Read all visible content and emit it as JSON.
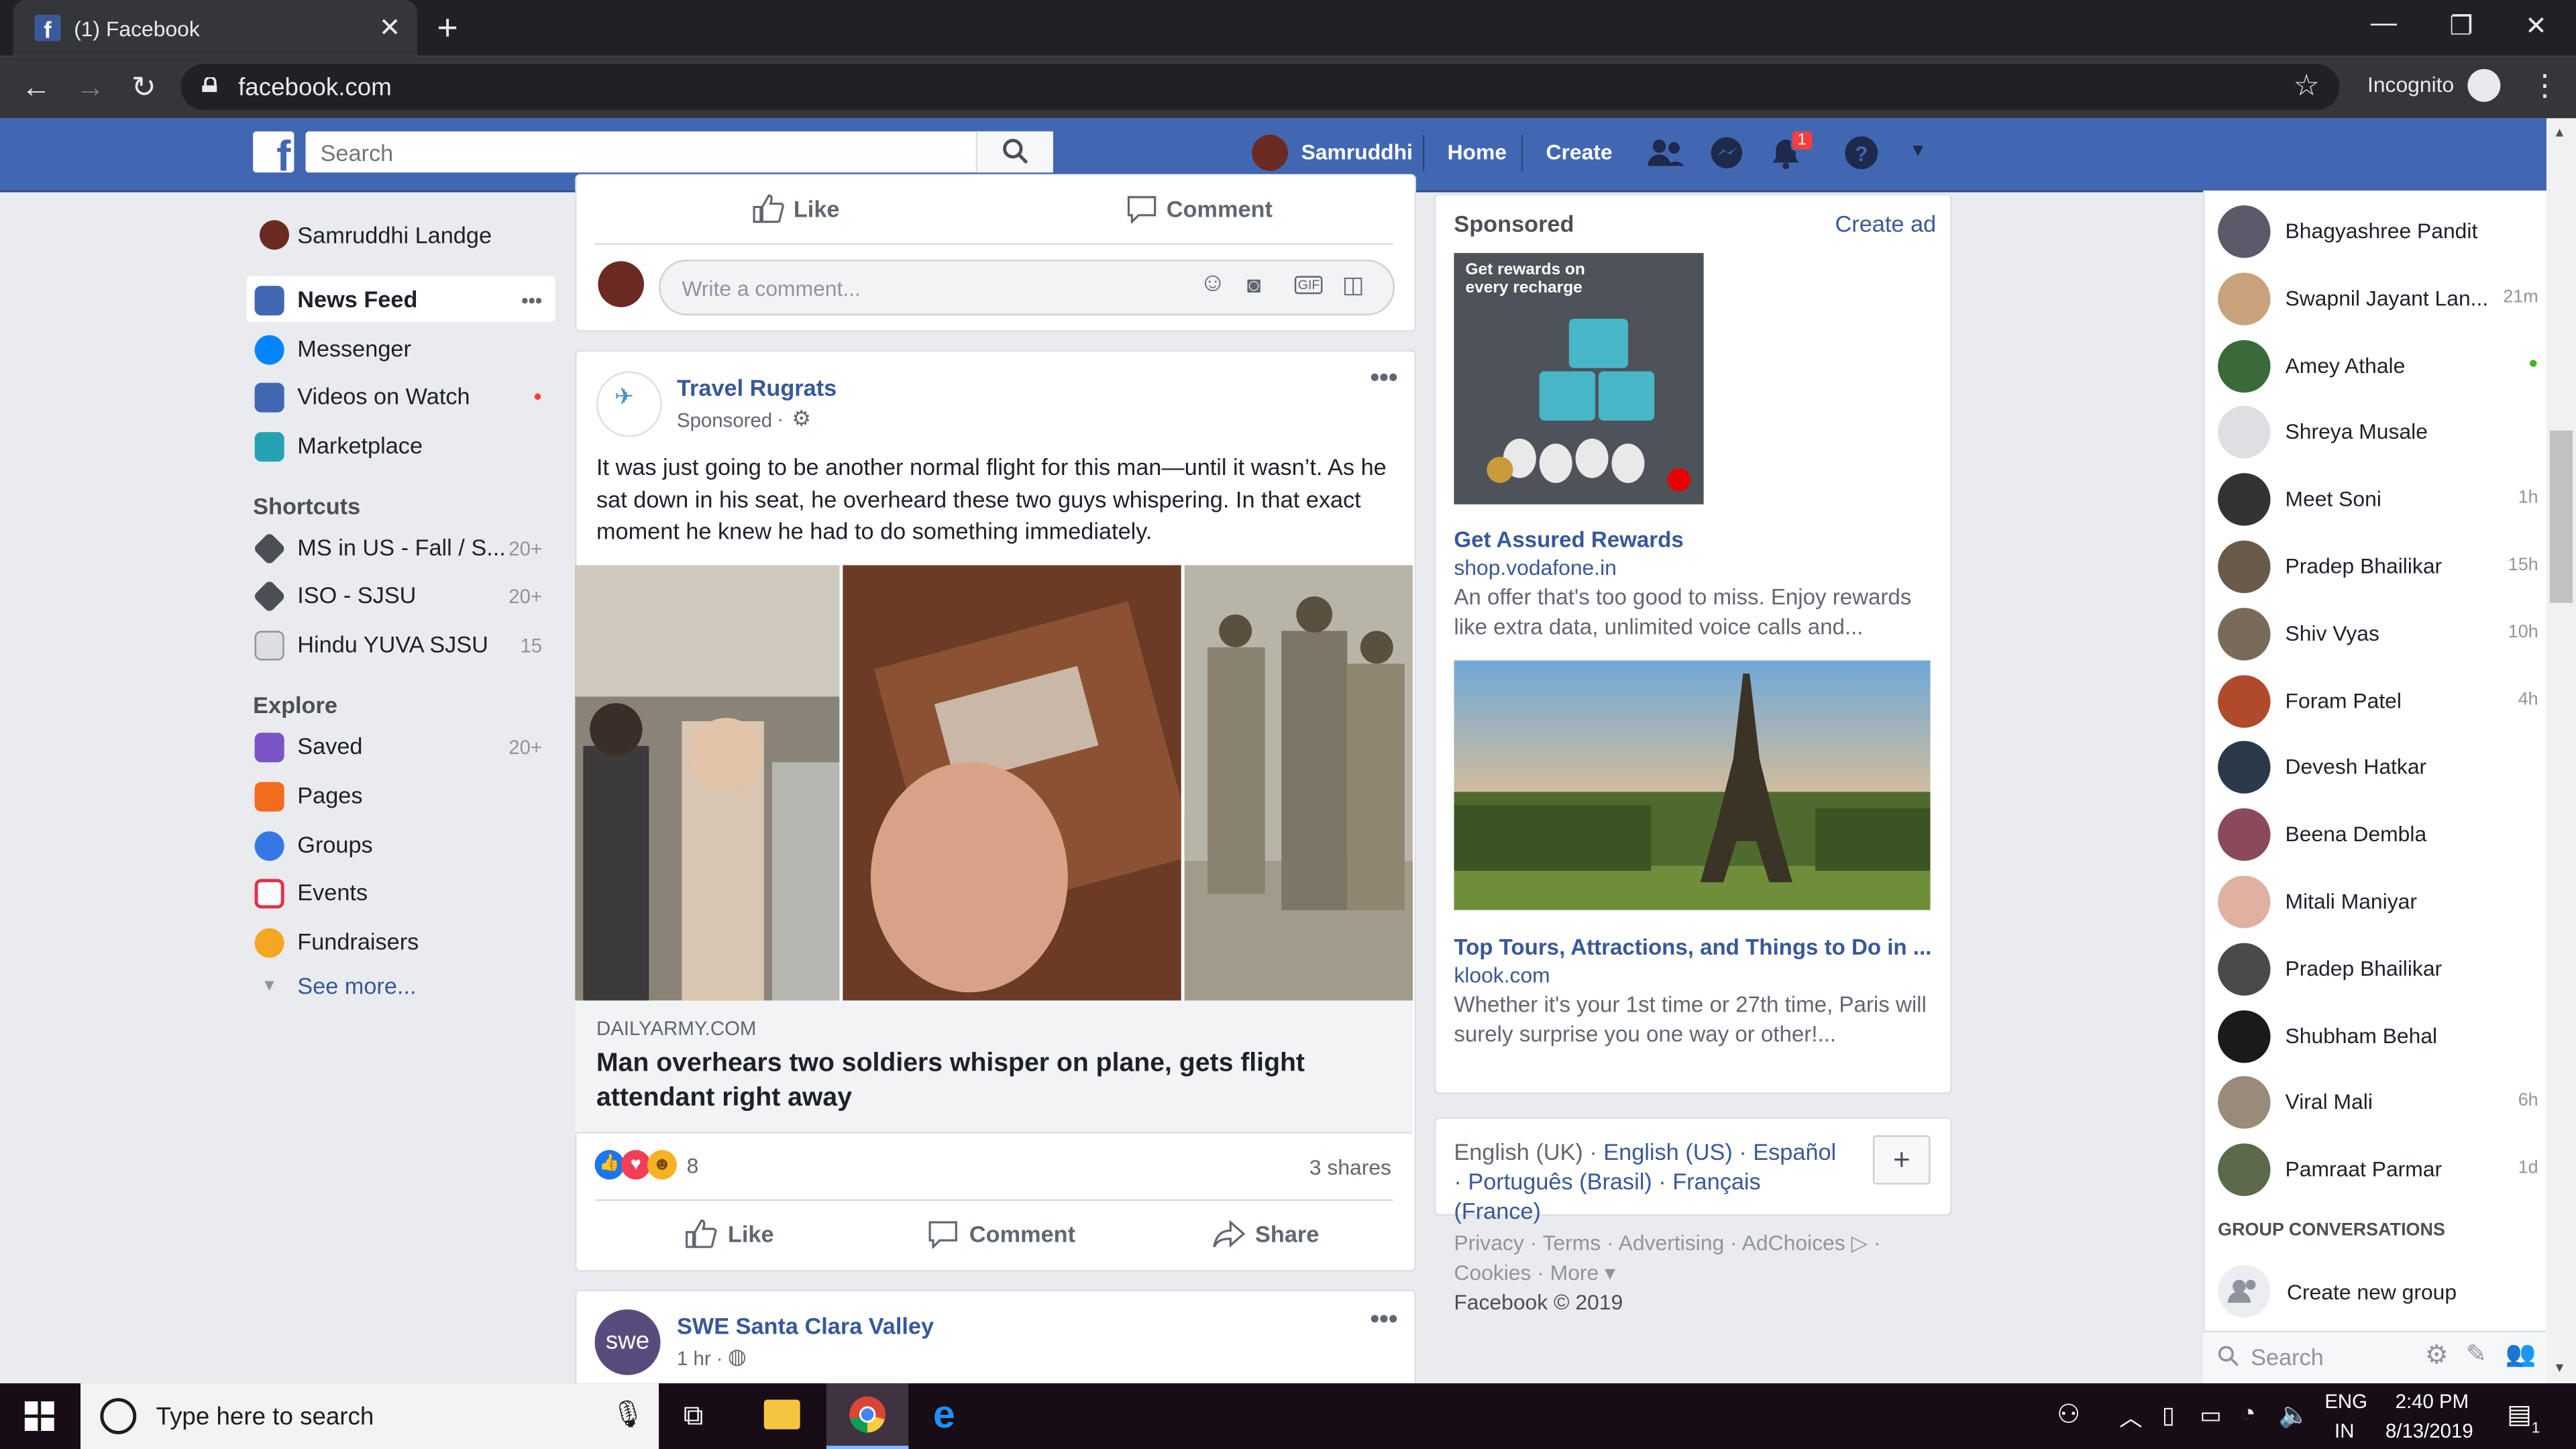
{
  "browser": {
    "tab_title": "(1) Facebook",
    "tab_favicon": "f",
    "url": "facebook.com",
    "incognito_label": "Incognito"
  },
  "fb_header": {
    "logo": "f",
    "search_placeholder": "Search",
    "user_name": "Samruddhi",
    "nav_home": "Home",
    "nav_create": "Create",
    "notification_count": "1"
  },
  "left_nav": {
    "profile_name": "Samruddhi Landge",
    "items": [
      {
        "label": "News Feed",
        "count": "•••",
        "color": "#4267b2"
      },
      {
        "label": "Messenger",
        "count": "",
        "color": "#0084ff"
      },
      {
        "label": "Videos on Watch",
        "count": "●",
        "color": "#4267b2"
      },
      {
        "label": "Marketplace",
        "count": "",
        "color": "#25a3b5"
      }
    ],
    "shortcuts_title": "Shortcuts",
    "shortcuts": [
      {
        "label": "MS in US - Fall / S...",
        "count": "20+"
      },
      {
        "label": "ISO - SJSU",
        "count": "20+"
      },
      {
        "label": "Hindu YUVA SJSU",
        "count": "15"
      }
    ],
    "explore_title": "Explore",
    "explore": [
      {
        "label": "Saved",
        "count": "20+",
        "color": "#7b55c4"
      },
      {
        "label": "Pages",
        "count": "",
        "color": "#f36b1c"
      },
      {
        "label": "Groups",
        "count": "",
        "color": "#3578e5"
      },
      {
        "label": "Events",
        "count": "",
        "color": "#e4304b"
      },
      {
        "label": "Fundraisers",
        "count": "",
        "color": "#f5a623"
      }
    ],
    "see_more": "See more..."
  },
  "prev_post": {
    "like": "Like",
    "comment": "Comment",
    "comment_placeholder": "Write a comment..."
  },
  "post": {
    "author": "Travel Rugrats",
    "sponsored": "Sponsored",
    "text": "It was just going to be another normal flight for this man—until it wasn’t. As he sat down in his seat, he overheard these two guys whispering. In that exact moment he knew he had to do something immediately.",
    "link_domain": "DAILYARMY.COM",
    "link_title": "Man overhears two soldiers whisper on plane, gets flight attendant right away",
    "reaction_count": "8",
    "shares": "3 shares",
    "like": "Like",
    "comment": "Comment",
    "share": "Share"
  },
  "next_post": {
    "author": "SWE Santa Clara Valley",
    "time": "1 hr ·",
    "logo_text": "swe"
  },
  "sponsored": {
    "title": "Sponsored",
    "create_ad": "Create ad",
    "ads": [
      {
        "image_caption": "Get rewards on every recharge",
        "headline": "Get Assured Rewards",
        "domain": "shop.vodafone.in",
        "desc": "An offer that's too good to miss. Enjoy rewards like extra data, unlimited voice calls and..."
      },
      {
        "headline": "Top Tours, Attractions, and Things to Do in ...",
        "domain": "klook.com",
        "desc": "Whether it's your 1st time or 27th time, Paris will surely surprise you one way or other!..."
      }
    ]
  },
  "languages": {
    "current": "English (UK) ·",
    "options": [
      "English (US) ·",
      "Español ·",
      "Português (Brasil) ·",
      "Français (France)"
    ]
  },
  "footer": {
    "line1": "Privacy · Terms · Advertising · AdChoices ▷ ·",
    "line2": "Cookies · More ▾",
    "copyright": "Facebook © 2019"
  },
  "chat": {
    "contacts": [
      {
        "name": "Bhagyashree Pandit",
        "time": "",
        "color": "#5a5a6a"
      },
      {
        "name": "Swapnil Jayant Lan...",
        "time": "21m",
        "color": "#c8a27a"
      },
      {
        "name": "Amey Athale",
        "time": "●",
        "color": "#3a6a3a"
      },
      {
        "name": "Shreya Musale",
        "time": "",
        "color": "#dddfe2"
      },
      {
        "name": "Meet Soni",
        "time": "1h",
        "color": "#333333"
      },
      {
        "name": "Pradep Bhailikar",
        "time": "15h",
        "color": "#6a5a4a"
      },
      {
        "name": "Shiv Vyas",
        "time": "10h",
        "color": "#7a6a5a"
      },
      {
        "name": "Foram Patel",
        "time": "4h",
        "color": "#b04a2a"
      },
      {
        "name": "Devesh Hatkar",
        "time": "",
        "color": "#2a3a4a"
      },
      {
        "name": "Beena Dembla",
        "time": "",
        "color": "#8a4a5a"
      },
      {
        "name": "Mitali Maniyar",
        "time": "",
        "color": "#e0b0a0"
      },
      {
        "name": "Pradep Bhailikar",
        "time": "",
        "color": "#4a4a4a"
      },
      {
        "name": "Shubham Behal",
        "time": "",
        "color": "#1a1a1a"
      },
      {
        "name": "Viral Mali",
        "time": "6h",
        "color": "#9a8a7a"
      },
      {
        "name": "Pamraat Parmar",
        "time": "1d",
        "color": "#5a6a4a"
      }
    ],
    "group_title": "GROUP CONVERSATIONS",
    "create_group": "Create new group",
    "search_placeholder": "Search"
  },
  "taskbar": {
    "search_placeholder": "Type here to search",
    "lang1": "ENG",
    "lang2": "IN",
    "time": "2:40 PM",
    "date": "8/13/2019"
  }
}
